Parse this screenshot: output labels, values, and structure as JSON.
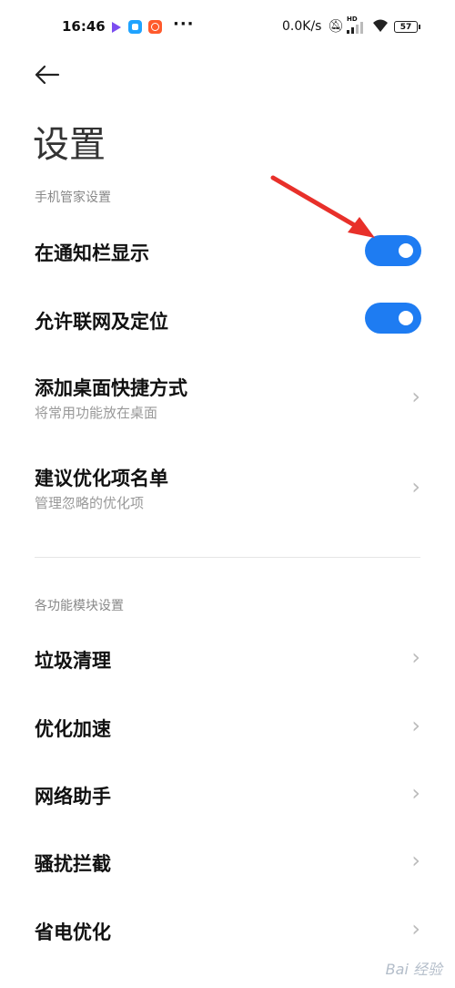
{
  "status_bar": {
    "time": "16:46",
    "dots": "···",
    "net_speed": "0.0K/s",
    "hd": "HD",
    "battery": "57"
  },
  "header": {
    "back_icon": "arrow-left-icon",
    "title": "设置"
  },
  "sections": [
    {
      "label": "手机管家设置",
      "items": [
        {
          "title": "在通知栏显示",
          "type": "toggle",
          "on": true
        },
        {
          "title": "允许联网及定位",
          "type": "toggle",
          "on": true
        },
        {
          "title": "添加桌面快捷方式",
          "subtitle": "将常用功能放在桌面",
          "type": "link"
        },
        {
          "title": "建议优化项名单",
          "subtitle": "管理忽略的优化项",
          "type": "link"
        }
      ]
    },
    {
      "label": "各功能模块设置",
      "items": [
        {
          "title": "垃圾清理",
          "type": "link"
        },
        {
          "title": "优化加速",
          "type": "link"
        },
        {
          "title": "网络助手",
          "type": "link"
        },
        {
          "title": "骚扰拦截",
          "type": "link"
        },
        {
          "title": "省电优化",
          "type": "link"
        }
      ]
    }
  ],
  "chevron": "›",
  "watermark": "Bai 经验",
  "colors": {
    "toggle_on": "#1e7cf2",
    "annotation_arrow": "#e8302a"
  }
}
